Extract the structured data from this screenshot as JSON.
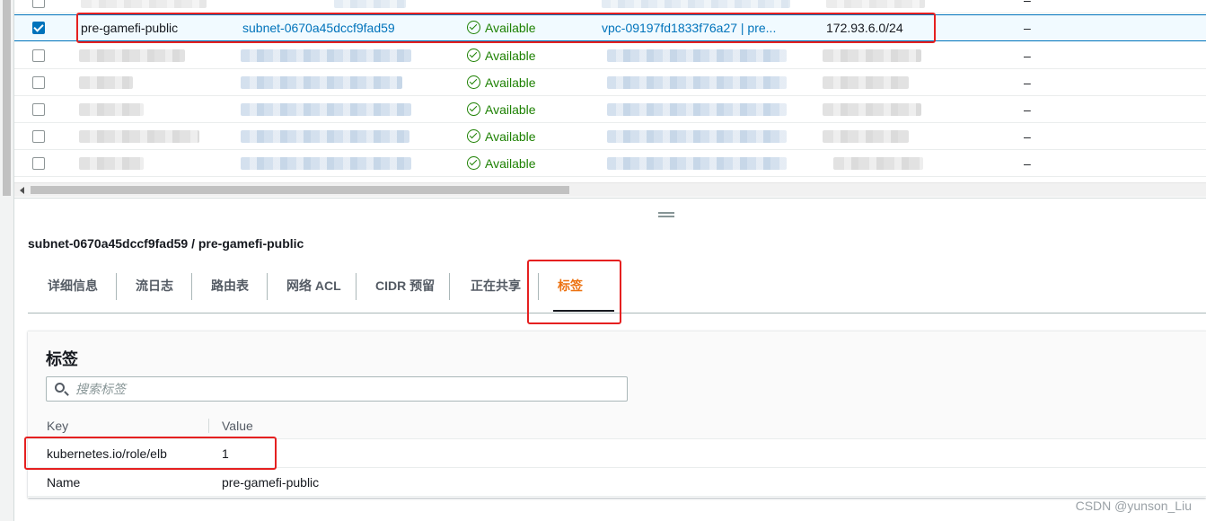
{
  "subnet_table": {
    "top_row": {
      "name": "pre-...-tgw-priv...",
      "dash": "–"
    },
    "rows": [
      {
        "selected": true,
        "name": "pre-gamefi-public",
        "subnet_id": "subnet-0670a45dccf9fad59",
        "status": "Available",
        "vpc": "vpc-09197fd1833f76a27 | pre...",
        "cidr": "172.93.6.0/24",
        "dash": "–"
      },
      {
        "selected": false,
        "status": "Available",
        "dash": "–"
      },
      {
        "selected": false,
        "status": "Available",
        "dash": "–"
      },
      {
        "selected": false,
        "status": "Available",
        "dash": "–"
      },
      {
        "selected": false,
        "status": "Available",
        "dash": "–"
      },
      {
        "selected": false,
        "status": "Available",
        "dash": "–"
      }
    ]
  },
  "detail_panel": {
    "title": "subnet-0670a45dccf9fad59 / pre-gamefi-public",
    "tabs": [
      {
        "label": "详细信息",
        "active": false
      },
      {
        "label": "流日志",
        "active": false
      },
      {
        "label": "路由表",
        "active": false
      },
      {
        "label": "网络 ACL",
        "active": false
      },
      {
        "label": "CIDR 预留",
        "active": false
      },
      {
        "label": "正在共享",
        "active": false
      },
      {
        "label": "标签",
        "active": true
      }
    ]
  },
  "tags": {
    "heading": "标签",
    "search": {
      "placeholder": "搜索标签",
      "value": ""
    },
    "columns": {
      "key": "Key",
      "value": "Value"
    },
    "rows": [
      {
        "key": "kubernetes.io/role/elb",
        "value": "1"
      },
      {
        "key": "Name",
        "value": "pre-gamefi-public"
      }
    ]
  },
  "watermark": "CSDN @yunson_Liu",
  "colors": {
    "link": "#0073bb",
    "status_available": "#1d8102",
    "active_tab": "#ec7211",
    "highlight_box": "#e52020"
  }
}
